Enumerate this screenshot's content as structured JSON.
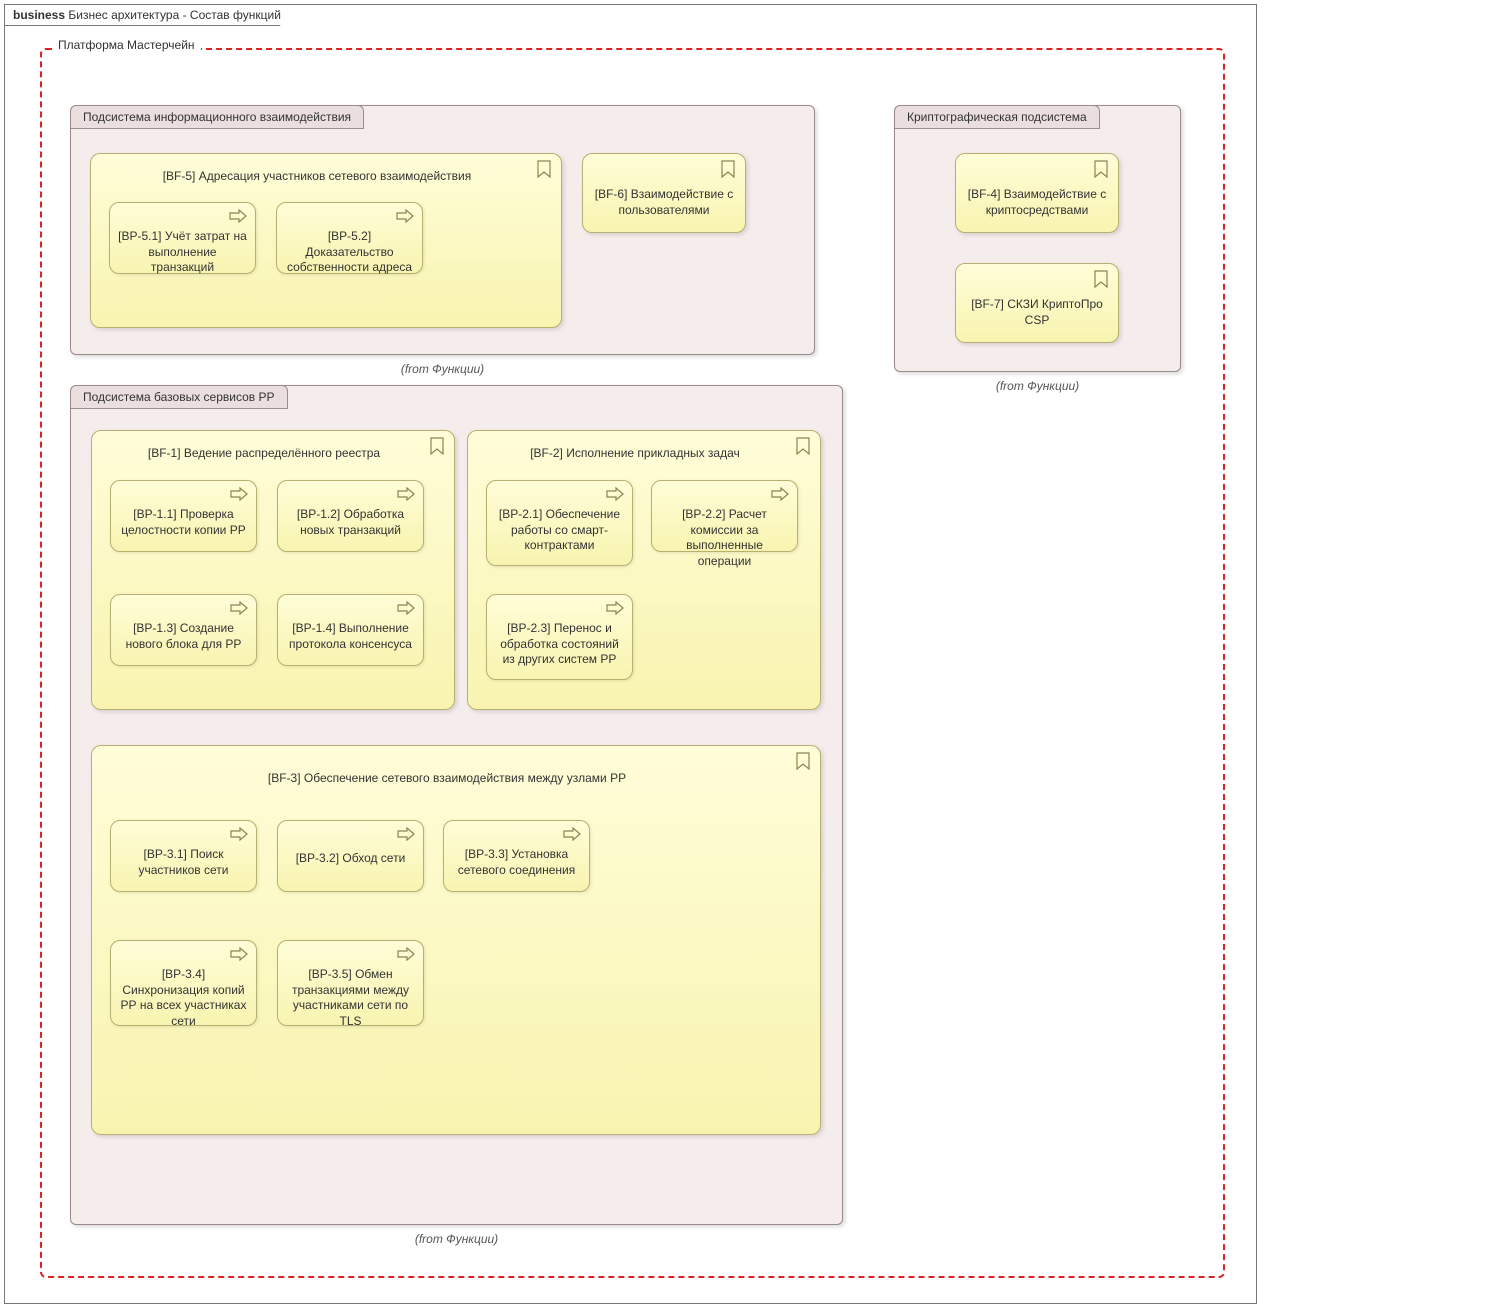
{
  "frame": {
    "prefix": "business",
    "title": "Бизнес архитектура - Состав функций"
  },
  "platform": {
    "title": "Платформа Мастерчейн"
  },
  "from_label": "(from Функции)",
  "subsystems": {
    "info": {
      "title": "Подсистема информационного взаимодействия"
    },
    "crypto": {
      "title": "Криптографическая подсистема"
    },
    "base": {
      "title": "Подсистема базовых сервисов РР"
    }
  },
  "bf5": {
    "title": "[BF-5] Адресация участников сетевого взаимодействия",
    "bp51": "[BP-5.1] Учёт затрат на выполнение транзакций",
    "bp52": "[BP-5.2] Доказательство собственности адреса"
  },
  "bf6": {
    "title": "[BF-6] Взаимодействие с пользователями"
  },
  "bf4": {
    "title": "[BF-4] Взаимодействие с криптосредствами"
  },
  "bf7": {
    "title": "[BF-7] СКЗИ КриптоПро CSP"
  },
  "bf1": {
    "title": "[BF-1] Ведение распределённого реестра",
    "bp11": "[BP-1.1] Проверка целостности копии РР",
    "bp12": "[BP-1.2] Обработка новых транзакций",
    "bp13": "[BP-1.3] Создание нового блока для РР",
    "bp14": "[BP-1.4] Выполнение протокола консенсуса"
  },
  "bf2": {
    "title": "[BF-2] Исполнение прикладных задач",
    "bp21": "[BP-2.1] Обеспечение работы со смарт-контрактами",
    "bp22": "[BP-2.2] Расчет комиссии за выполненные операции",
    "bp23": "[BP-2.3] Перенос и обработка состояний из других систем РР"
  },
  "bf3": {
    "title": "[BF-3] Обеспечение сетевого взаимодействия между узлами РР",
    "bp31": "[BP-3.1] Поиск участников сети",
    "bp32": "[BP-3.2] Обход сети",
    "bp33": "[BP-3.3] Установка сетевого соединения",
    "bp34": "[BP-3.4] Синхронизация копий РР на всех участниках сети",
    "bp35": "[BP-3.5]  Обмен транзакциями между участниками сети по TLS"
  }
}
